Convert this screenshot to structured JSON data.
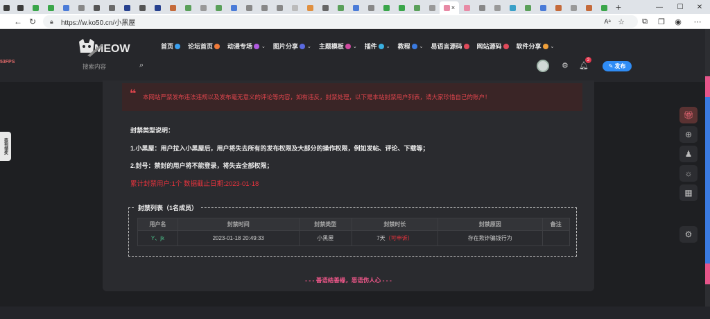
{
  "browser": {
    "url": "https://w.ko50.cn/小黑屋",
    "active_tab_close": "×",
    "new_tab": "+",
    "win_min": "—",
    "win_max": "☐",
    "win_close": "✕",
    "tab_favicon_colors": [
      "#3c3c3c",
      "#3aa64a",
      "#3aa64a",
      "#4a7bd8",
      "#888",
      "#555",
      "#6a6a6a",
      "#27418f",
      "#555",
      "#27418f",
      "#c56a3a",
      "#5aa05a",
      "#999",
      "#5aa05a",
      "#4a7bd8",
      "#888",
      "#888",
      "#888",
      "#bbb",
      "#e09040",
      "#666",
      "#5aa05a",
      "#4a7bd8",
      "#888",
      "#3aa64a",
      "#3aa64a",
      "#5aa05a",
      "#999",
      "#e88aa5",
      "#e88aa5",
      "#888",
      "#999",
      "#3aa0c8",
      "#5aa05a",
      "#4a7bd8",
      "#c56a3a",
      "#999",
      "#c56a3a",
      "#3aa64a"
    ]
  },
  "fps": "53FPS",
  "header": {
    "logo_text": "MEOW",
    "nav": [
      {
        "label": "首页",
        "emoji_color": "#3aa0f0",
        "caret": false
      },
      {
        "label": "论坛首页",
        "emoji_color": "#f07a3a",
        "caret": false
      },
      {
        "label": "动漫专场",
        "emoji_color": "#b05ae0",
        "caret": true
      },
      {
        "label": "图片分享",
        "emoji_color": "#5a6ae0",
        "caret": true
      },
      {
        "label": "主题模板",
        "emoji_color": "#d04aa0",
        "caret": true
      },
      {
        "label": "插件",
        "emoji_color": "#3ab0e0",
        "caret": true
      },
      {
        "label": "教程",
        "emoji_color": "#3a7ae0",
        "caret": true
      },
      {
        "label": "易语言源码",
        "emoji_color": "#e04a5a",
        "caret": false
      },
      {
        "label": "网站源码",
        "emoji_color": "#e04a5a",
        "caret": false
      },
      {
        "label": "软件分享",
        "emoji_color": "#f0a03a",
        "caret": true
      }
    ],
    "search_placeholder": "搜索内容",
    "notification_count": "2",
    "publish_label": "发布"
  },
  "main": {
    "notice": "本网站严禁发布违法违规以及发布毫无意义的评论等内容，如有违反，封禁处理，以下是本站封禁用户列表，请大家珍惜自己的账户！",
    "types_title": "封禁类型说明：",
    "type1": "1.小黑屋：用户拉入小黑屋后，用户将失去所有的发布权限及大部分的操作权限，例如发帖、评论、下载等；",
    "type2": "2.封号：禁封的用户将不能登录，将失去全部权限；",
    "total": "累计封禁用户:1个 数据截止日期:2023-01-18",
    "list_title": "封禁列表（1名成员）",
    "table": {
      "headers": [
        "用户名",
        "封禁时间",
        "封禁类型",
        "封禁时长",
        "封禁原因",
        "备注"
      ],
      "rows": [
        {
          "username": "Y、jk",
          "time": "2023-01-18 20:49:33",
          "type": "小黑屋",
          "duration": "7天",
          "appeal": "（可申诉）",
          "reason": "存在欺诈骗钱行为",
          "note": ""
        }
      ]
    },
    "footer": "- - - 善语结善缘，恶语伤人心 - - -"
  },
  "sidebar_left_tag": "签到领奖"
}
